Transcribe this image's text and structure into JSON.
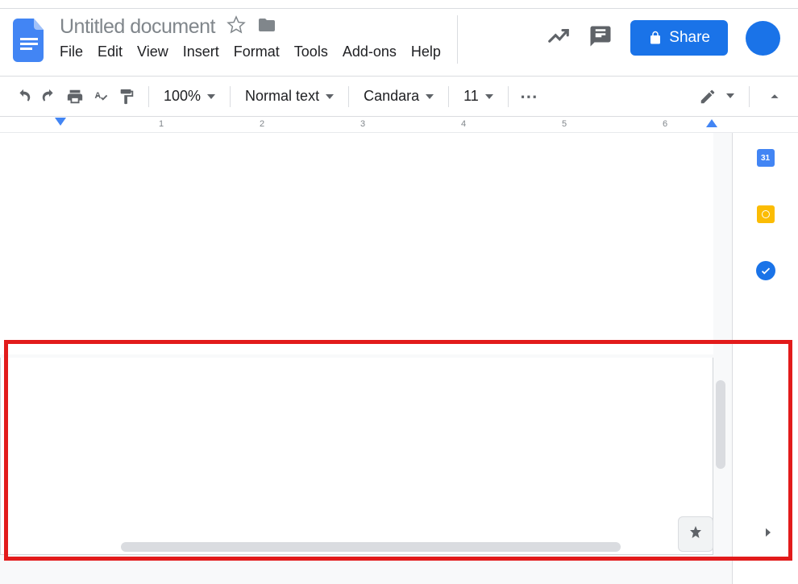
{
  "header": {
    "title": "Untitled document",
    "menubar": [
      "File",
      "Edit",
      "View",
      "Insert",
      "Format",
      "Tools",
      "Add-ons",
      "Help"
    ],
    "share_label": "Share"
  },
  "toolbar": {
    "zoom": "100%",
    "style": "Normal text",
    "font": "Candara",
    "font_size": "11"
  },
  "ruler": {
    "numbers": [
      "1",
      "2",
      "3",
      "4",
      "5",
      "6"
    ]
  },
  "sidepanel": {
    "calendar_day": "31"
  }
}
